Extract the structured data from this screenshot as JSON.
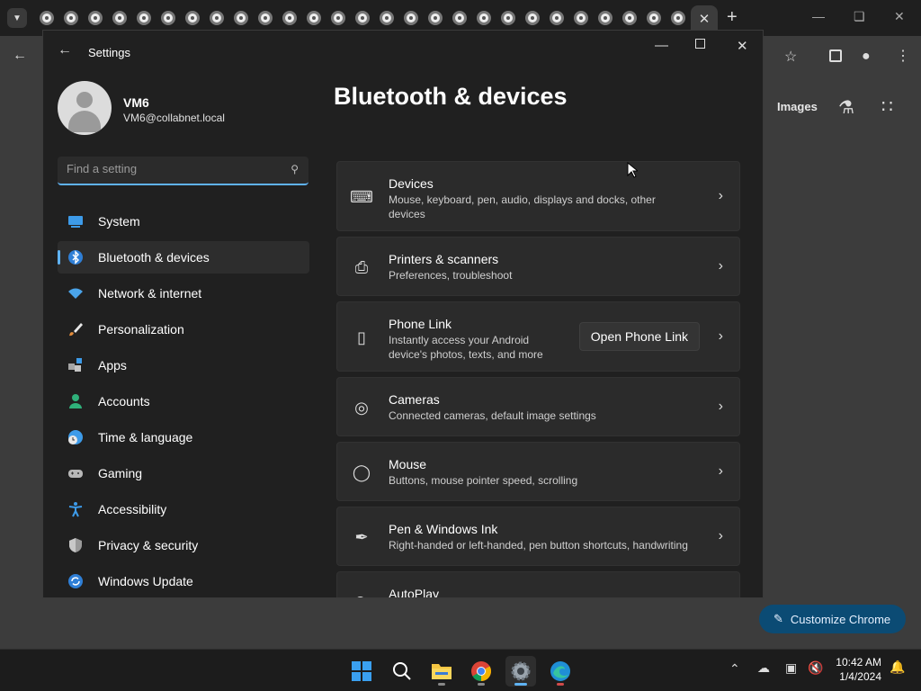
{
  "chrome": {
    "images_label": "Images",
    "customize_label": "Customize Chrome"
  },
  "settings": {
    "window_title": "Settings",
    "user": {
      "name": "VM6",
      "email": "VM6@collabnet.local"
    },
    "search": {
      "placeholder": "Find a setting"
    },
    "nav": [
      {
        "label": "System",
        "icon": "monitor-icon"
      },
      {
        "label": "Bluetooth & devices",
        "icon": "bluetooth-icon",
        "selected": true
      },
      {
        "label": "Network & internet",
        "icon": "wifi-icon"
      },
      {
        "label": "Personalization",
        "icon": "brush-icon"
      },
      {
        "label": "Apps",
        "icon": "apps-icon"
      },
      {
        "label": "Accounts",
        "icon": "person-icon"
      },
      {
        "label": "Time & language",
        "icon": "globe-clock-icon"
      },
      {
        "label": "Gaming",
        "icon": "gamepad-icon"
      },
      {
        "label": "Accessibility",
        "icon": "accessibility-icon"
      },
      {
        "label": "Privacy & security",
        "icon": "shield-icon"
      },
      {
        "label": "Windows Update",
        "icon": "sync-icon"
      }
    ],
    "page_title": "Bluetooth & devices",
    "cards": [
      {
        "title": "Devices",
        "subtitle": "Mouse, keyboard, pen, audio, displays and docks, other devices",
        "icon": "devices-icon"
      },
      {
        "title": "Printers & scanners",
        "subtitle": "Preferences, troubleshoot",
        "icon": "printer-icon"
      },
      {
        "title": "Phone Link",
        "subtitle": "Instantly access your Android device's photos, texts, and more",
        "icon": "phone-icon",
        "button": "Open Phone Link"
      },
      {
        "title": "Cameras",
        "subtitle": "Connected cameras, default image settings",
        "icon": "camera-icon"
      },
      {
        "title": "Mouse",
        "subtitle": "Buttons, mouse pointer speed, scrolling",
        "icon": "mouse-icon"
      },
      {
        "title": "Pen & Windows Ink",
        "subtitle": "Right-handed or left-handed, pen button shortcuts, handwriting",
        "icon": "pen-icon"
      },
      {
        "title": "AutoPlay",
        "subtitle": "",
        "icon": "autoplay-icon"
      }
    ]
  },
  "taskbar": {
    "time": "10:42 AM",
    "date": "1/4/2024"
  },
  "colors": {
    "accent": "#5fb2f2",
    "window_bg": "#202020",
    "card_bg": "#2b2b2b"
  }
}
